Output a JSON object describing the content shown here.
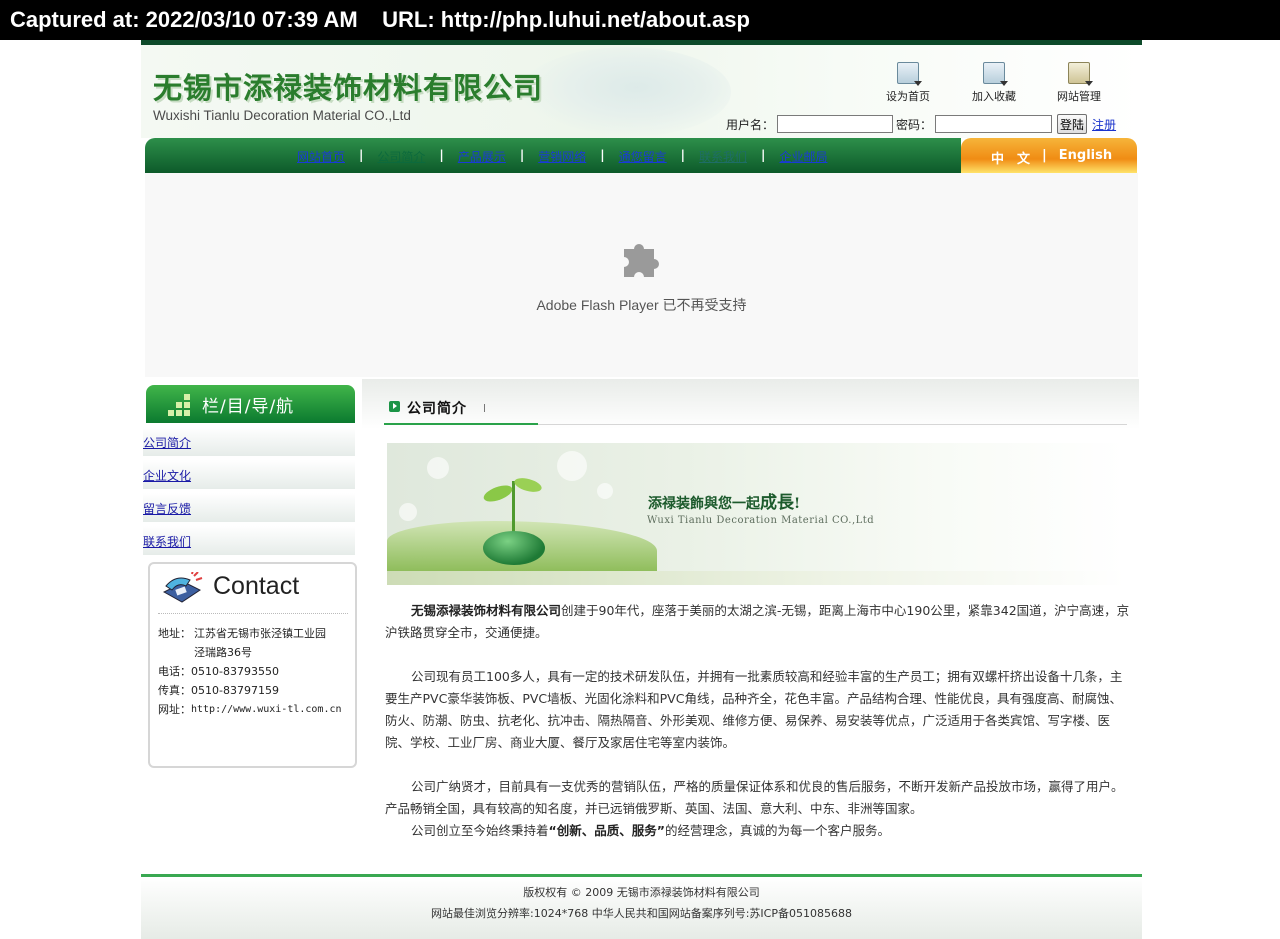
{
  "capture": {
    "text": "Captured at: 2022/03/10 07:39 AM    URL: http://php.luhui.net/about.asp"
  },
  "header": {
    "logo_cn": "无锡市添禄装饰材料有限公司",
    "logo_en": "Wuxishi Tianlu Decoration Material CO.,Ltd",
    "tools": [
      {
        "label": "设为首页",
        "icon": "set-homepage-icon"
      },
      {
        "label": "加入收藏",
        "icon": "add-favorite-icon"
      },
      {
        "label": "网站管理",
        "icon": "site-admin-icon"
      }
    ],
    "login": {
      "username_label": "用户名：",
      "password_label": "密码：",
      "username_value": "",
      "password_value": "",
      "login_button": "登陆",
      "register_link": "注册"
    }
  },
  "nav": {
    "items": [
      "网站首页",
      "公司简介",
      "产品展示",
      "营销网络",
      "通您留言",
      "联系我们",
      "企业邮局"
    ],
    "separator": "|"
  },
  "lang": {
    "cn": "中　文",
    "separator": "|",
    "en": "English"
  },
  "flash": {
    "message": "Adobe Flash Player 已不再受支持",
    "icon": "puzzle-plugin-icon"
  },
  "sidebar": {
    "title": "栏/目/导/航",
    "items": [
      "公司简介",
      "企业文化",
      "留言反馈",
      "联系我们"
    ],
    "contact": {
      "title": "Contact",
      "address_label": "地址：",
      "address_line1": "江苏省无锡市张泾镇工业园",
      "address_line2": "泾瑞路36号",
      "phone_label": "电话：",
      "phone": "0510-83793550",
      "fax_label": "传真：",
      "fax": "0510-83797159",
      "web_label": "网址：",
      "web": "http://www.wuxi-tl.com.cn"
    }
  },
  "main": {
    "title": "公司简介",
    "banner": {
      "slogan_a": "添禄装飾與您一起",
      "slogan_b": "成長",
      "slogan_c": "!",
      "slogan_en": "Wuxi Tianlu Decoration Material CO.,Ltd"
    },
    "p1_bold": "无锡添禄装饰材料有限公司",
    "p1_rest": "创建于90年代，座落于美丽的太湖之滨-无锡，距离上海市中心190公里，紧靠342国道，沪宁高速，京沪铁路贯穿全市，交通便捷。",
    "p2": "公司现有员工100多人，具有一定的技术研发队伍，并拥有一批素质较高和经验丰富的生产员工；拥有双螺杆挤出设备十几条，主要生产PVC豪华装饰板、PVC墙板、光固化涂料和PVC角线，品种齐全，花色丰富。产品结构合理、性能优良，具有强度高、耐腐蚀、防火、防潮、防虫、抗老化、抗冲击、隔热隔音、外形美观、维修方便、易保养、易安装等优点，广泛适用于各类宾馆、写字楼、医院、学校、工业厂房、商业大厦、餐厅及家居住宅等室内装饰。",
    "p3": "公司广纳贤才，目前具有一支优秀的营销队伍，严格的质量保证体系和优良的售后服务，不断开发新产品投放市场，赢得了用户。产品畅销全国，具有较高的知名度，并已远销俄罗斯、英国、法国、意大利、中东、非洲等国家。",
    "p4_a": "公司创立至今始终秉持着",
    "p4_bold": "“创新、品质、服务”",
    "p4_b": "的经营理念，真诚的为每一个客户服务。"
  },
  "footer": {
    "line1": "版权权有 © 2009  无锡市添禄装饰材料有限公司",
    "line2": "网站最佳浏览分辨率:1024*768  中华人民共和国网站备案序列号:苏ICP备051085688"
  },
  "colors": {
    "nav_green": "#0d5a2a",
    "accent_green": "#2aa24a",
    "lang_orange": "#f08c14",
    "link_blue": "#1a3bd6"
  }
}
